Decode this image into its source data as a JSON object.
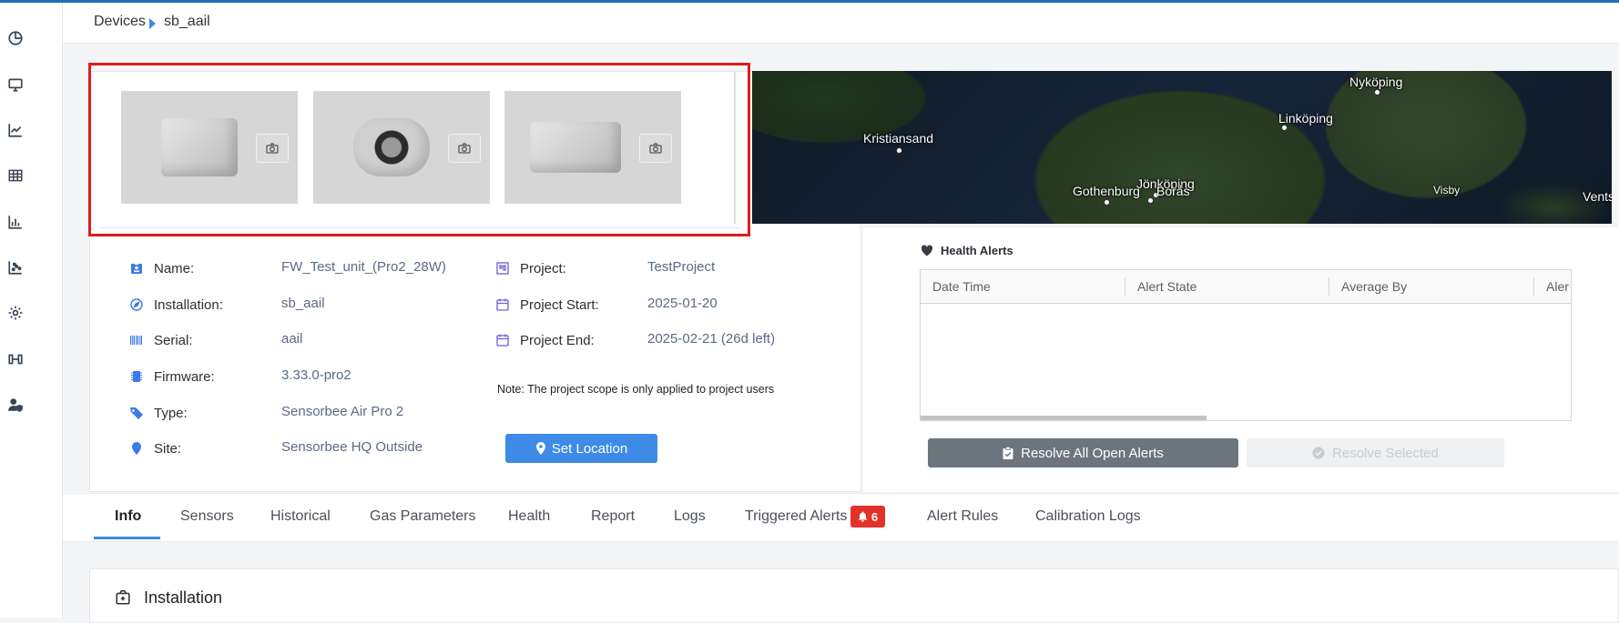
{
  "breadcrumb": {
    "root": "Devices",
    "current": "sb_aail"
  },
  "sidebar": {
    "items": [
      {
        "icon": "pie-chart-icon"
      },
      {
        "icon": "monitor-icon"
      },
      {
        "icon": "line-chart-icon"
      },
      {
        "icon": "table-icon"
      },
      {
        "icon": "bar-chart-icon"
      },
      {
        "icon": "scatter-chart-icon"
      },
      {
        "icon": "gear-icon"
      },
      {
        "icon": "sensor-icon"
      },
      {
        "icon": "user-shield-icon"
      }
    ]
  },
  "map": {
    "labels": [
      "Kristiansand",
      "Nyköping",
      "Linköping",
      "Jönköping",
      "Gothenburg",
      "Borås",
      "Visby",
      "Vents"
    ]
  },
  "device": {
    "name_label": "Name:",
    "name": "FW_Test_unit_(Pro2_28W)",
    "installation_label": "Installation:",
    "installation": "sb_aail",
    "serial_label": "Serial:",
    "serial": "aail",
    "firmware_label": "Firmware:",
    "firmware": "3.33.0-pro2",
    "type_label": "Type:",
    "type": "Sensorbee Air Pro 2",
    "site_label": "Site:",
    "site": "Sensorbee HQ Outside"
  },
  "project": {
    "project_label": "Project:",
    "project": "TestProject",
    "start_label": "Project Start:",
    "start": "2025-01-20",
    "end_label": "Project End:",
    "end": "2025-02-21 (26d left)",
    "note": "Note: The project scope is only applied to project users",
    "set_location": "Set Location"
  },
  "health_alerts": {
    "title": "Health Alerts",
    "columns": [
      "Date Time",
      "Alert State",
      "Average By",
      "Aler"
    ],
    "resolve_all": "Resolve All Open Alerts",
    "resolve_selected": "Resolve Selected"
  },
  "tabs": {
    "items": [
      "Info",
      "Sensors",
      "Historical",
      "Gas Parameters",
      "Health",
      "Report",
      "Logs",
      "Triggered Alerts",
      "Alert Rules",
      "Calibration Logs"
    ],
    "triggered_count": "6"
  },
  "installation_section": {
    "title": "Installation"
  }
}
